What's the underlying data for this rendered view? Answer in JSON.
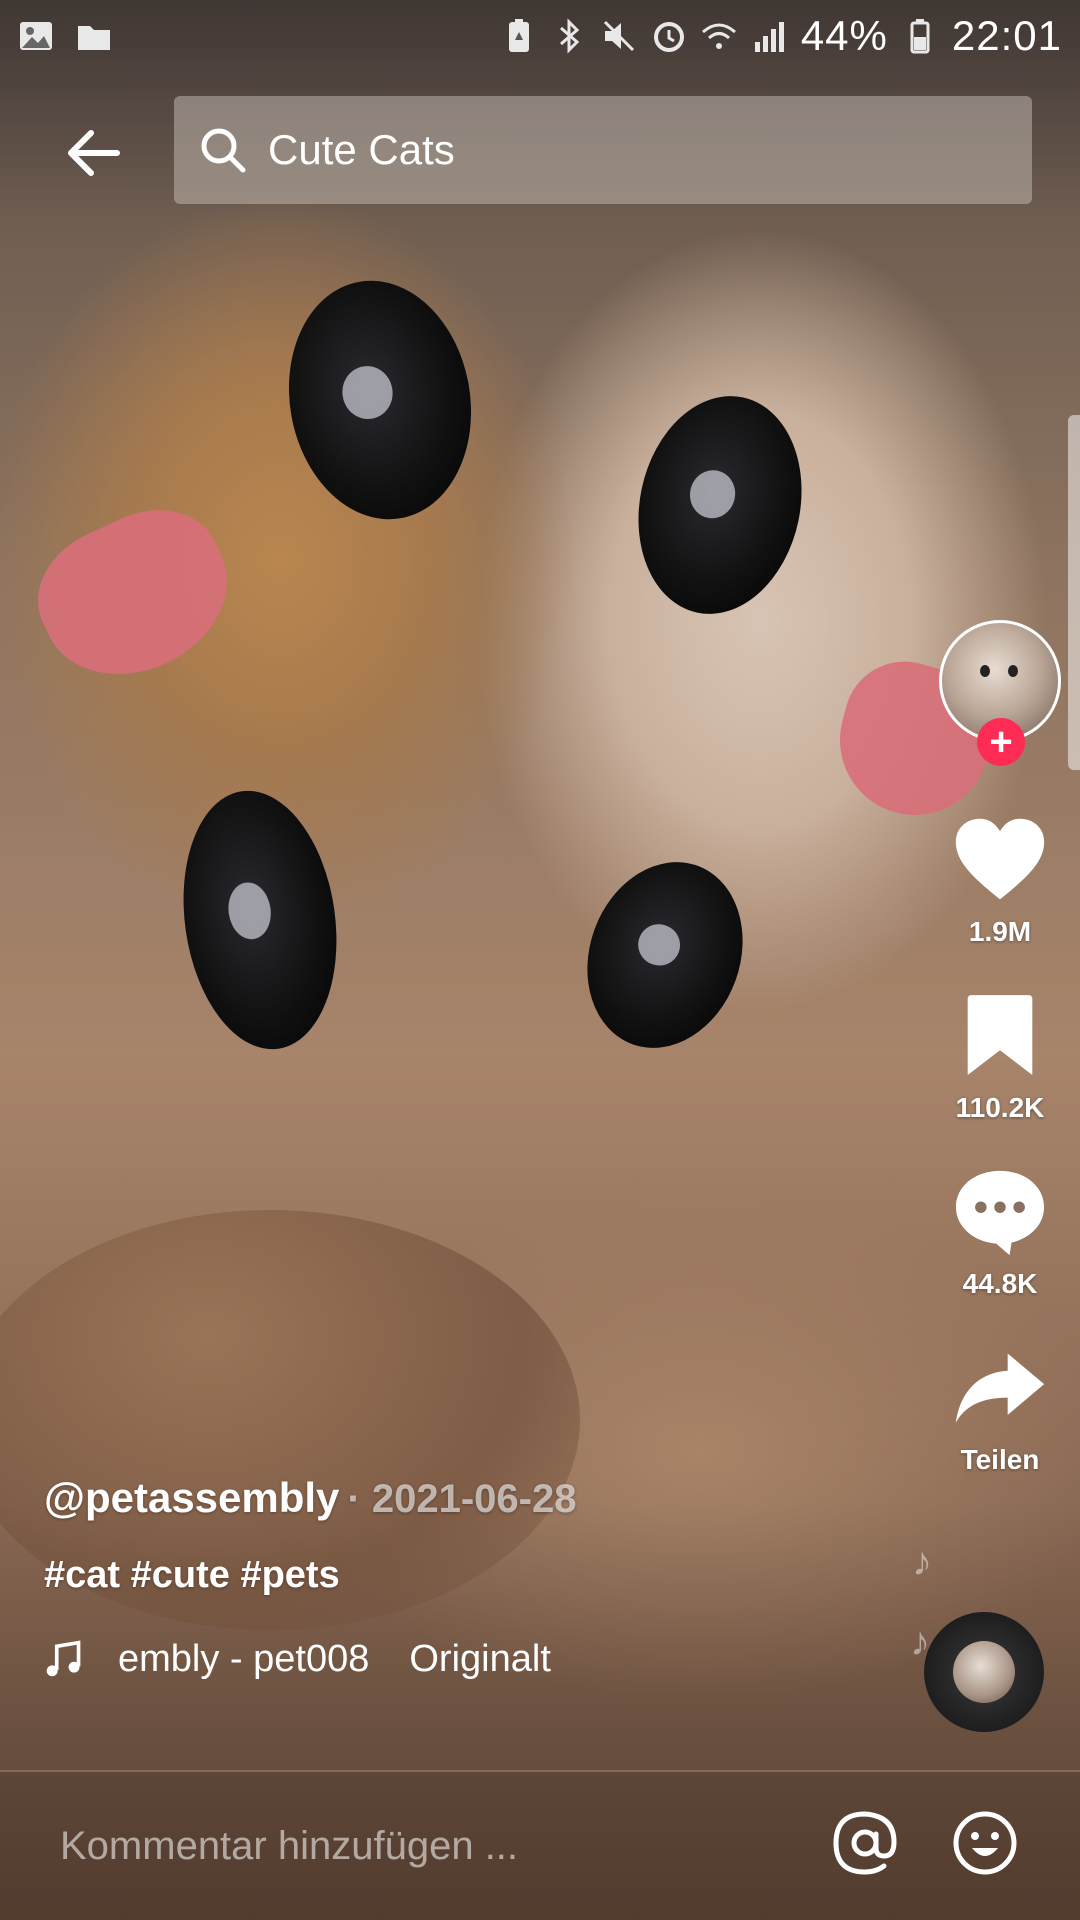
{
  "status_bar": {
    "battery_percent": "44%",
    "time": "22:01",
    "left_icons": [
      "gallery-icon",
      "folder-icon"
    ],
    "right_icons": [
      "battery-saver-icon",
      "bluetooth-icon",
      "mute-icon",
      "alarm-icon",
      "wifi-icon",
      "signal-icon",
      "battery-icon"
    ]
  },
  "search": {
    "query": "Cute Cats"
  },
  "post": {
    "username": "@petassembly",
    "date": "· 2021-06-28",
    "hashtags": "#cat #cute #pets",
    "music_text_1": "embly - pet008",
    "music_text_2": "Originalt"
  },
  "rail": {
    "likes": "1.9M",
    "saves": "110.2K",
    "comments": "44.8K",
    "share_label": "Teilen"
  },
  "comment_bar": {
    "placeholder": "Kommentar hinzufügen ..."
  },
  "colors": {
    "follow_accent": "#fe2c55"
  }
}
